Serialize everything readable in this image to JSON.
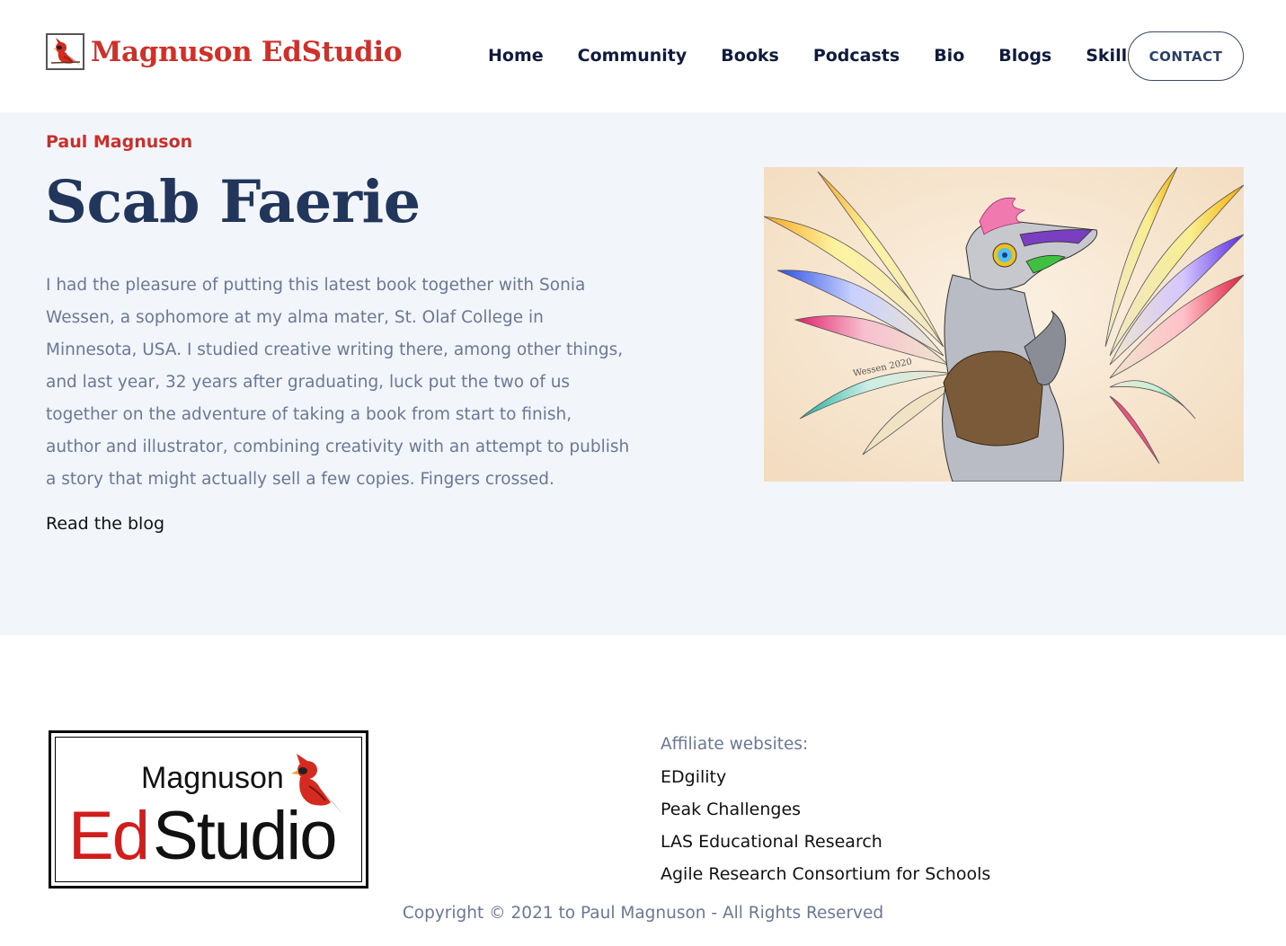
{
  "header": {
    "logo_text": "Magnuson EdStudio",
    "nav": [
      "Home",
      "Community",
      "Books",
      "Podcasts",
      "Bio",
      "Blogs",
      "Skills"
    ],
    "contact_label": "CONTACT"
  },
  "hero": {
    "eyebrow": "Paul Magnuson",
    "title": "Scab Faerie",
    "body": "I had the pleasure of putting this latest book together with Sonia Wessen, a sophomore at my alma mater, St. Olaf College in Minnesota, USA. I studied creative writing there, among other things, and last year, 32 years after graduating, luck put the two of us together on the adventure of taking a book from start to finish, author and illustrator, combining creativity with an attempt to publish a story that might actually sell a few copies. Fingers crossed.",
    "link_label": "Read the blog",
    "image_signature": "Wessen 2020"
  },
  "footer": {
    "logo_top": "Magnuson",
    "logo_ed": "Ed",
    "logo_studio": "Studio",
    "affiliates_heading": "Affiliate websites:",
    "affiliates": [
      "EDgility",
      "Peak Challenges",
      "LAS Educational Research",
      "Agile Research Consortium for Schools"
    ],
    "copyright": "Copyright © 2021 to Paul Magnuson - All Rights Reserved"
  },
  "colors": {
    "brand_red": "#d0302a",
    "navy": "#22355a",
    "hero_bg": "#f2f6fb",
    "muted_text": "#6a7896"
  },
  "icons": [
    "cardinal-logo-icon"
  ]
}
